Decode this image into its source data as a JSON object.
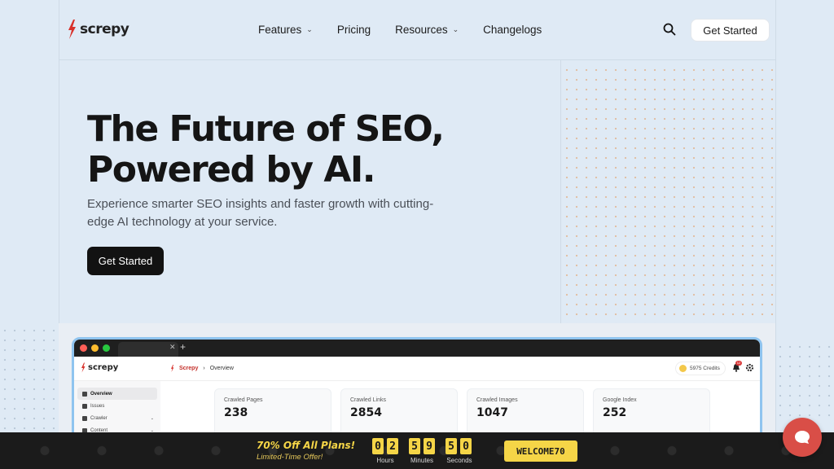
{
  "header": {
    "logo_text": "screpy",
    "nav": [
      {
        "label": "Features",
        "has_dropdown": true
      },
      {
        "label": "Pricing",
        "has_dropdown": false
      },
      {
        "label": "Resources",
        "has_dropdown": true
      },
      {
        "label": "Changelogs",
        "has_dropdown": false
      }
    ],
    "search_icon": "search-icon",
    "cta_label": "Get Started"
  },
  "hero": {
    "title_line1": "The Future of SEO,",
    "title_line2": "Powered by AI.",
    "subtitle_line1": "Experience smarter SEO insights and faster growth with cutting-",
    "subtitle_line2": "edge AI technology at your service.",
    "cta_label": "Get Started"
  },
  "preview": {
    "app_logo_text": "screpy",
    "breadcrumb": {
      "brand": "Screpy",
      "separator": "›",
      "page": "Overview"
    },
    "credits": "5975 Credits",
    "notification_count": "12",
    "sidebar": [
      {
        "label": "Overview",
        "active": true,
        "icon": "home-icon",
        "expandable": false
      },
      {
        "label": "Issues",
        "active": false,
        "icon": "bar-chart-icon",
        "expandable": false
      },
      {
        "label": "Crawler",
        "active": false,
        "icon": "crawler-icon",
        "expandable": true
      },
      {
        "label": "Content",
        "active": false,
        "icon": "content-icon",
        "expandable": true
      }
    ],
    "stats": [
      {
        "label": "Crawled Pages",
        "value": "238"
      },
      {
        "label": "Crawled Links",
        "value": "2854"
      },
      {
        "label": "Crawled Images",
        "value": "1047"
      },
      {
        "label": "Google Index",
        "value": "252"
      }
    ]
  },
  "promo": {
    "title": "70% Off All Plans!",
    "subtitle": "Limited-Time Offer!",
    "countdown": {
      "hours": [
        "0",
        "2"
      ],
      "minutes": [
        "5",
        "9"
      ],
      "seconds": [
        "5",
        "0"
      ],
      "hours_label": "Hours",
      "minutes_label": "Minutes",
      "seconds_label": "Seconds"
    },
    "coupon_code": "WELCOME70"
  },
  "colors": {
    "page_bg": "#dfeaf5",
    "brand_red": "#d8312b",
    "promo_yellow": "#f5d547",
    "dark": "#121212",
    "chat_red": "#d94e47"
  }
}
